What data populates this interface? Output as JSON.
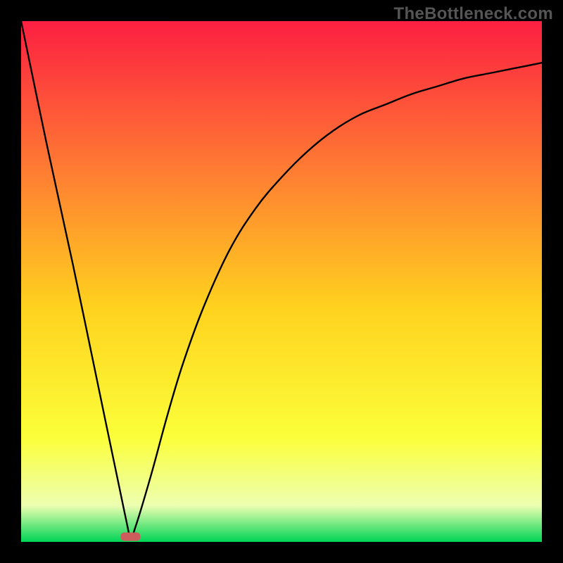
{
  "watermark": "TheBottleneck.com",
  "chart_data": {
    "type": "line",
    "title": "",
    "xlabel": "",
    "ylabel": "",
    "xlim": [
      0,
      100
    ],
    "ylim": [
      0,
      100
    ],
    "grid": false,
    "legend": false,
    "marker": {
      "x": 21,
      "y": 1,
      "color": "#cd5c5c"
    },
    "series": [
      {
        "name": "curve",
        "x": [
          0,
          5,
          10,
          15,
          20,
          21,
          22,
          25,
          28,
          31,
          35,
          40,
          45,
          50,
          55,
          60,
          65,
          70,
          75,
          80,
          85,
          90,
          95,
          100
        ],
        "y": [
          100,
          76,
          53,
          29,
          5,
          1,
          3,
          13,
          24,
          34,
          45,
          56,
          64,
          70,
          75,
          79,
          82,
          84,
          86,
          87.5,
          89,
          90,
          91,
          92
        ]
      }
    ],
    "background_gradient": {
      "top": "#fc1f41",
      "mid_top": "#ff7a33",
      "mid": "#ffd21e",
      "mid_low": "#fbff3a",
      "low": "#edffb1",
      "bottom": "#00d455"
    }
  }
}
